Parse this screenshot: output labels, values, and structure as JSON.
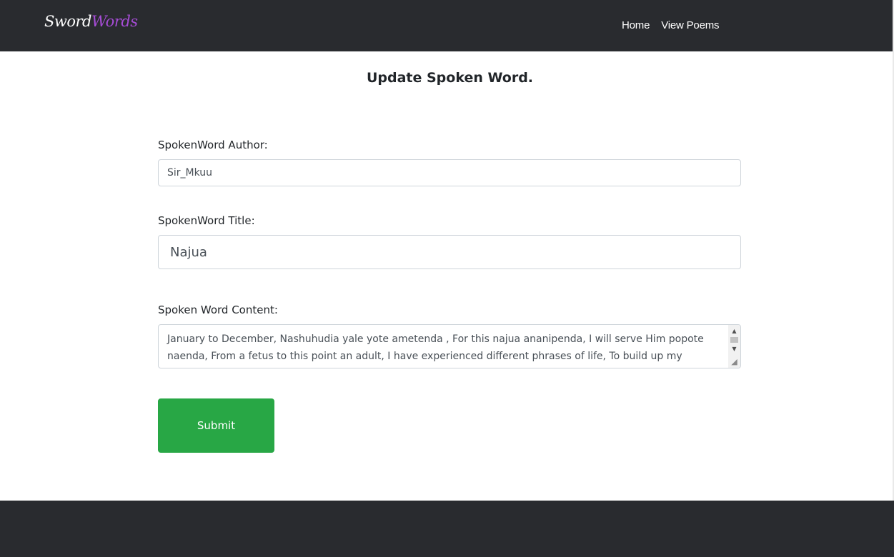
{
  "navbar": {
    "brand_part1": "Sword",
    "brand_part2": "Words",
    "links": [
      {
        "label": "Home"
      },
      {
        "label": "View Poems"
      }
    ]
  },
  "page": {
    "title": "Update Spoken Word."
  },
  "form": {
    "author_label": "SpokenWord Author:",
    "author_value": "Sir_Mkuu",
    "title_label": "SpokenWord Title:",
    "title_value": "Najua",
    "content_label": "Spoken Word Content:",
    "content_value": "January to December,  Nashuhudia yale yote ametenda , For this najua ananipenda,  I will serve Him popote naenda,  From a fetus to this point an adult, I have experienced different phrases of life, To build up my",
    "submit_label": "Submit"
  },
  "colors": {
    "navbar_bg": "#292b2f",
    "brand_accent": "#a64cd6",
    "submit_bg": "#28a745"
  },
  "icons": {
    "scroll_up": "scroll-up-arrow-icon",
    "scroll_down": "scroll-down-arrow-icon",
    "resize": "resize-grip-icon"
  }
}
